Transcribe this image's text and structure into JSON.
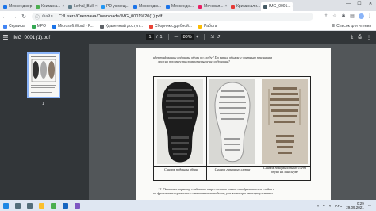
{
  "browser": {
    "tabs": [
      {
        "label": "Мессенджер",
        "color": "#1a73e8",
        "active": false
      },
      {
        "label": "Кримина...",
        "color": "#4caf50",
        "active": false
      },
      {
        "label": "Lethal_Bull",
        "color": "#607d8b",
        "active": false
      },
      {
        "label": "PD ук мещ...",
        "color": "#2196f3",
        "active": false
      },
      {
        "label": "Мессендж...",
        "color": "#1a73e8",
        "active": false
      },
      {
        "label": "Мессендж...",
        "color": "#1a73e8",
        "active": false
      },
      {
        "label": "Мочевая...",
        "color": "#e91e63",
        "active": false
      },
      {
        "label": "Криминали...",
        "color": "#e53935",
        "active": false
      },
      {
        "label": "IMG_0001...",
        "color": "#455a64",
        "active": true
      }
    ],
    "new_tab": "+",
    "window_controls": {
      "minimize": "—",
      "maximize": "☐",
      "close": "✕"
    }
  },
  "toolbar": {
    "back": "←",
    "forward": "→",
    "reload": "↻",
    "url_label": "Файл",
    "url": "C:/Users/Светлана/Downloads/IMG_0001%20(1).pdf",
    "icons": [
      "share-icon",
      "star-icon",
      "extensions-icon",
      "sidebar-icon",
      "profile-avatar",
      "more-icon"
    ]
  },
  "bookmarks": {
    "items": [
      {
        "label": "Сервисы",
        "color": "#4285f4"
      },
      {
        "label": "МРО",
        "color": "#34a853"
      },
      {
        "label": "Microsoft Word - F...",
        "color": "#1a73e8"
      },
      {
        "label": "Удаленный доступ...",
        "color": "#5f6368"
      },
      {
        "label": "Сборник судебной...",
        "color": "#ea4335"
      },
      {
        "label": "Работа",
        "color": "#fbbc04"
      }
    ],
    "reading_list": "Список для чтения"
  },
  "pdf": {
    "filename": "IMG_0001 (1).pdf",
    "current_page": "1",
    "page_separator": "/",
    "total_pages": "1",
    "zoom_out": "—",
    "zoom": "80%",
    "zoom_in": "+",
    "thumbnail_label": "1",
    "caption_top_line1": "идентификации подошвы обуви по следу? По каким общим и частным признакам",
    "caption_top_line2": "можно произвести сравнительное исследование?",
    "photo_labels": [
      "Снимок подошвы обуви",
      "Снимок гипсового слепка",
      "Снимок поверхностного следа обуви на линолеуме"
    ],
    "caption_bottom_line1": "12. Опишите картину следов ног и при наличии четко отобразившихся следов и",
    "caption_bottom_line2": "их фрагменты сравните с отпечатками подошв; укажите при этом результаты"
  },
  "taskbar": {
    "icons": [
      {
        "name": "windows-start-icon",
        "color": "#1e88e5"
      },
      {
        "name": "search-icon",
        "color": "#546e7a"
      },
      {
        "name": "task-view-icon",
        "color": "#546e7a"
      },
      {
        "name": "explorer-icon",
        "color": "#fbc02d"
      },
      {
        "name": "chrome-icon",
        "color": "#4caf50"
      },
      {
        "name": "word-icon",
        "color": "#1565c0"
      },
      {
        "name": "viber-icon",
        "color": "#7e57c2"
      }
    ],
    "language": "РУС",
    "time": "0:29",
    "date": "29.09.2021"
  }
}
